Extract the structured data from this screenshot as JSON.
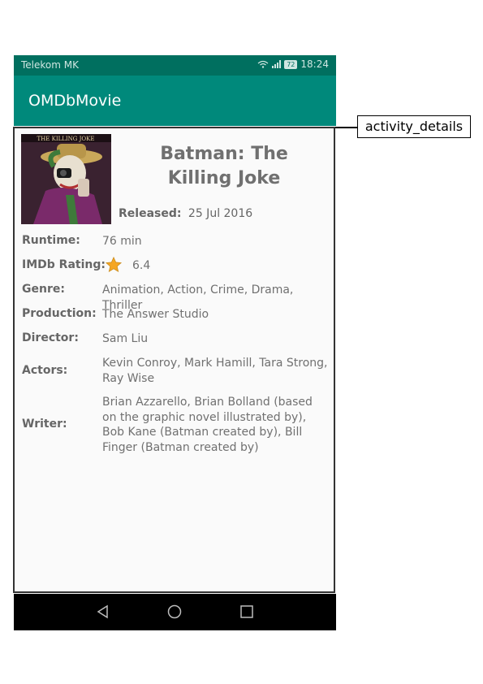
{
  "status_bar": {
    "carrier": "Telekom MK",
    "battery": "72",
    "time": "18:24"
  },
  "app_bar": {
    "title": "OMDbMovie"
  },
  "movie": {
    "poster_title": "THE KILLING JOKE",
    "title": "Batman: The Killing Joke",
    "released_label": "Released:",
    "released": "25 Jul 2016"
  },
  "details": [
    {
      "label": "Runtime:",
      "value": "76 min"
    },
    {
      "label": "IMDb Rating:",
      "value": "6.4",
      "icon": "star-icon"
    },
    {
      "label": "Genre:",
      "value": "Animation, Action, Crime, Drama, Thriller"
    },
    {
      "label": "Production:",
      "value": "The Answer Studio"
    },
    {
      "label": "Director:",
      "value": "Sam Liu"
    },
    {
      "label": "Actors:",
      "value": "Kevin Conroy, Mark Hamill, Tara Strong, Ray Wise"
    },
    {
      "label": "Writer:",
      "value": "Brian Azzarello, Brian Bolland (based on the graphic novel illustrated by), Bob Kane (Batman created by), Bill Finger (Batman created by)"
    }
  ],
  "annotation": {
    "label": "activity_details"
  },
  "nav_icons": [
    "back-icon",
    "home-icon",
    "recents-icon"
  ],
  "colors": {
    "status_bar": "#006f5f",
    "app_bar": "#00897b",
    "star": "#f5a623"
  }
}
